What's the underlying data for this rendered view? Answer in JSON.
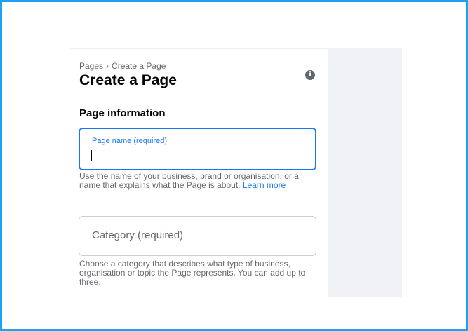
{
  "breadcrumb": {
    "parent": "Pages",
    "separator": "›",
    "current": "Create a Page"
  },
  "page_title": "Create a Page",
  "info_icon": {
    "glyph": "i",
    "icon": "info-icon"
  },
  "section_title": "Page information",
  "page_name_field": {
    "label": "Page name (required)",
    "value": ""
  },
  "page_name_help": {
    "text": "Use the name of your business, brand or organisation, or a name that explains what the Page is about.",
    "link": "Learn more"
  },
  "category_field": {
    "placeholder": "Category (required)"
  },
  "category_help": {
    "text": "Choose a category that describes what type of business, organisation or topic the Page represents. You can add up to three."
  },
  "colors": {
    "frame_border": "#1da1f2",
    "accent": "#1877f2",
    "right_area": "#f0f2f5"
  }
}
